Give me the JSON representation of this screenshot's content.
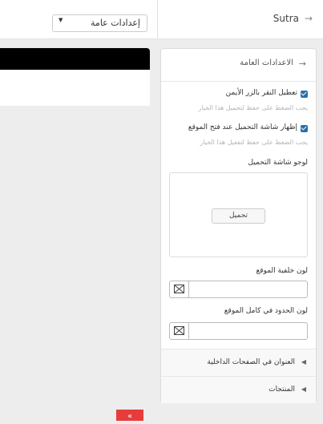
{
  "header": {
    "site_name": "Sutra",
    "back_icon": "arrow-right-icon",
    "settings_select": "إعدادات عامة"
  },
  "panel": {
    "title": "الاعدادات العامة",
    "options": [
      {
        "label": "تعطيل النقر بالزر الأيمن",
        "checked": true,
        "hint": "يجب الضغط على حفظ لتحميل هذا الخيار"
      },
      {
        "label": "إظهار شاشة التحميل عند فتح الموقع",
        "checked": true,
        "hint": "يجب الضغط على حفظ لتفعيل هذا الخيار"
      }
    ],
    "logo_label": "لوجو شاشة التحميل",
    "upload_button": "تحميل",
    "bg_color_label": "لون خلفية الموقع",
    "border_color_label": "لون الحدود في كامل الموقع",
    "sections": [
      {
        "label": "العنوان في الصفحات الداخلية"
      },
      {
        "label": "المنتجات"
      }
    ]
  },
  "footer": {
    "collapse_label": "«"
  },
  "colors": {
    "accent": "#2271b1",
    "red": "#e73c3c"
  }
}
